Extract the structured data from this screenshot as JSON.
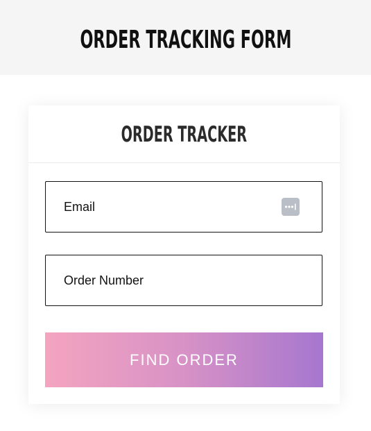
{
  "page": {
    "title": "ORDER TRACKING FORM"
  },
  "card": {
    "title": "ORDER TRACKER"
  },
  "form": {
    "email_placeholder": "Email",
    "order_number_placeholder": "Order Number",
    "submit_label": "FIND ORDER",
    "autofill_icon": "password-manager-autofill-icon"
  },
  "colors": {
    "gradient_start": "#f4a4bf",
    "gradient_end": "#a677cf",
    "header_band": "#f5f5f5"
  }
}
